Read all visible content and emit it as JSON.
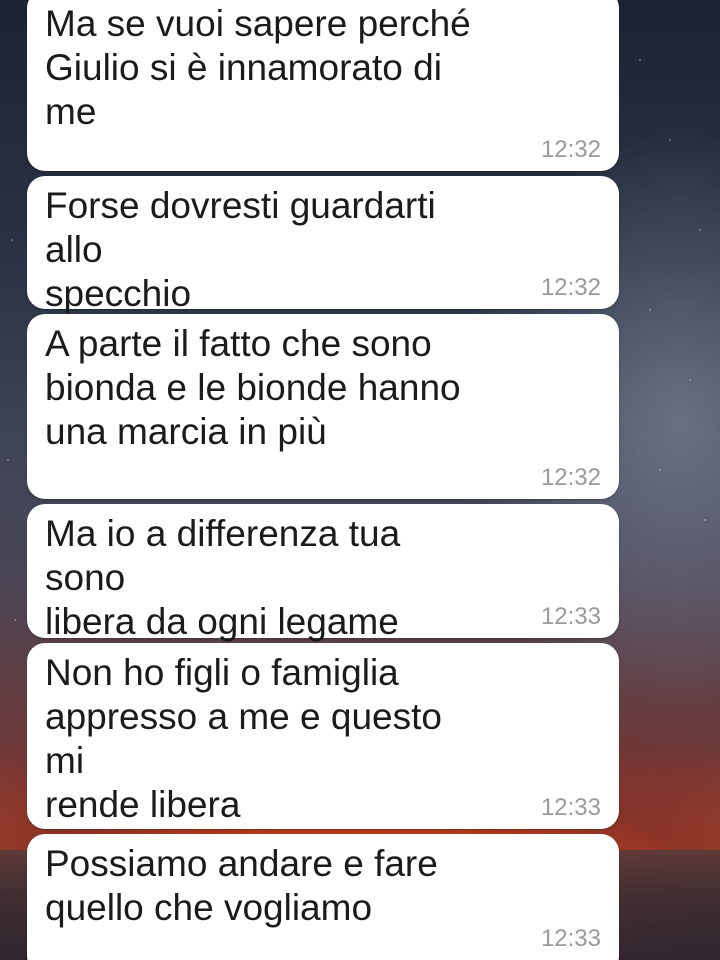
{
  "conversation": {
    "messages": [
      {
        "text": "Ma se vuoi sapere perché\nGiulio si è innamorato di me",
        "time": "12:32"
      },
      {
        "text": "Forse dovresti guardarti allo\nspecchio",
        "time": "12:32"
      },
      {
        "text": "A parte il fatto che sono\nbionda e le bionde hanno\nuna marcia in più",
        "time": "12:32"
      },
      {
        "text": "Ma io a differenza tua sono\nlibera da ogni legame",
        "time": "12:33"
      },
      {
        "text": "Non ho figli o famiglia\nappresso a me e questo mi\nrende libera",
        "time": "12:33"
      },
      {
        "text": "Possiamo andare e fare\nquello che vogliamo",
        "time": "12:33"
      }
    ]
  },
  "colors": {
    "bubble": "#ffffff",
    "text": "#1b1b1b",
    "timestamp": "#9a9a9a"
  }
}
